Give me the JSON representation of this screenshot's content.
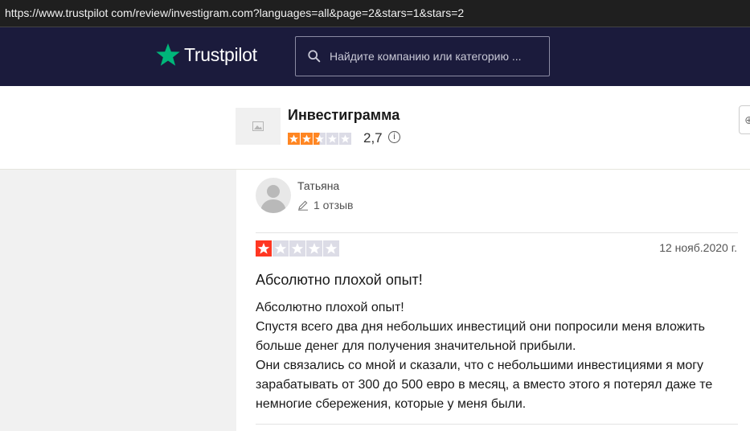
{
  "browser": {
    "url": "https://www.trustpilot com/review/investigram.com?languages=all&page=2&stars=1&stars=2"
  },
  "header": {
    "logo_text": "Trustpilot",
    "search_placeholder": "Найдите компанию или категорию ...",
    "icons": [
      "star-icon",
      "search-icon"
    ],
    "colors": {
      "background": "#1b1b3c",
      "logo_star": "#00b67a"
    }
  },
  "business": {
    "name": "Инвестиграмма",
    "trustscore": "2,7",
    "star_rating": 2.5,
    "stars_total": 5,
    "colors": {
      "star_filled": "#ff8622",
      "star_empty": "#dcdce6"
    },
    "icons": [
      "image-placeholder-icon",
      "info-icon"
    ]
  },
  "review": {
    "author": "Татьяна",
    "review_count": "1 отзыв",
    "rating": 1,
    "stars_total": 5,
    "date": "12 нояб.2020 г.",
    "title": "Абсолютно плохой опыт!",
    "body_lines": [
      "Абсолютно плохой опыт!",
      "Спустя всего два дня небольших инвестиций они попросили меня вложить больше денег для получения значительной прибыли.",
      "Они связались со мной и сказали, что с небольшими инвестициями я могу зарабатывать от 300 до 500 евро в месяц, а вместо этого я потерял даже те немногие сбережения, которые у меня были."
    ],
    "colors": {
      "star_filled": "#ff3722",
      "star_empty": "#dcdce6"
    },
    "icons": [
      "avatar-icon",
      "pencil-icon"
    ]
  }
}
